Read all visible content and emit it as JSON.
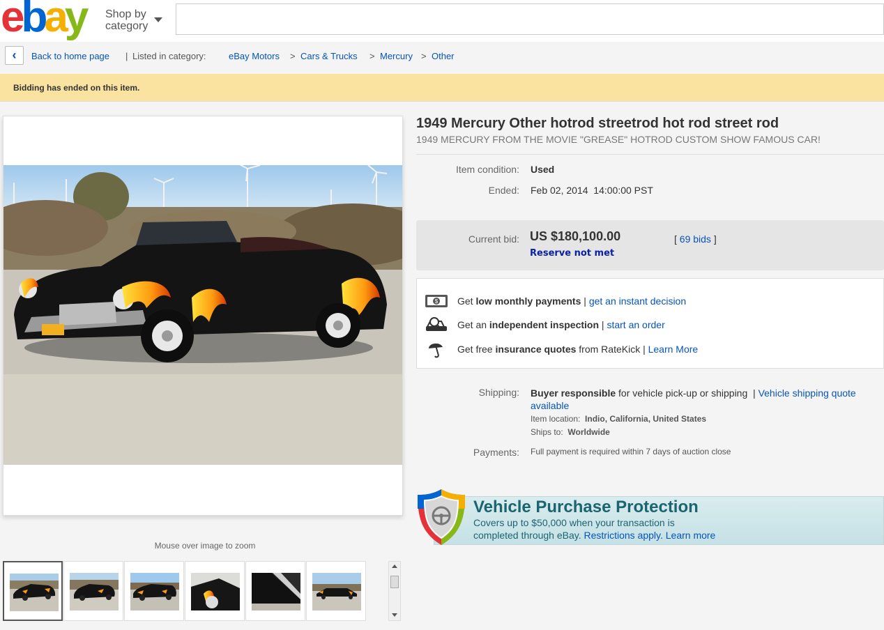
{
  "header": {
    "logo_text": "ebay",
    "shop_by_line1": "Shop by",
    "shop_by_line2": "category",
    "search_placeholder": ""
  },
  "breadcrumb": {
    "back_label": "Back to home page",
    "separator": "|",
    "listed_in": "Listed in category:",
    "items": [
      "eBay Motors",
      "Cars & Trucks",
      "Mercury",
      "Other"
    ],
    "arrow": ">"
  },
  "banner": {
    "text": "Bidding has ended on this item."
  },
  "gallery": {
    "zoom_hint": "Mouse over image to zoom",
    "thumbnail_count": 6
  },
  "listing": {
    "title": "1949 Mercury Other hotrod streetrod hot rod street rod",
    "subtitle": "1949 MERCURY FROM THE MOVIE \"GREASE\" HOTROD CUSTOM SHOW FAMOUS CAR!",
    "condition_label": "Item condition:",
    "condition_value": "Used",
    "ended_label": "Ended:",
    "ended_value": "Feb 02, 2014  14:00:00 PST"
  },
  "bid": {
    "label": "Current bid:",
    "price": "US $180,100.00",
    "reserve": "Reserve not met",
    "bids_open": "[",
    "bids_link": "69 bids",
    "bids_close": "]"
  },
  "offers": [
    {
      "icon": "money-icon",
      "pre": "Get ",
      "bold": "low monthly payments",
      "mid": " | ",
      "link": "get an instant decision"
    },
    {
      "icon": "inspection-icon",
      "pre": "Get an ",
      "bold": "independent inspection",
      "mid": " | ",
      "link": "start an order"
    },
    {
      "icon": "umbrella-icon",
      "pre": "Get free ",
      "bold": "insurance quotes",
      "mid": " from RateKick | ",
      "link": "Learn More"
    }
  ],
  "shipping": {
    "label": "Shipping:",
    "bold": "Buyer responsible",
    "text": " for vehicle pick-up or shipping",
    "sep": "|",
    "link_part1": "Vehicle shipping quote",
    "link_part2": "available",
    "location_label": "Item location:",
    "location_value": "Indio, California, United States",
    "ships_label": "Ships to:",
    "ships_value": "Worldwide"
  },
  "payments": {
    "label": "Payments:",
    "value": "Full payment is required within 7 days of auction close"
  },
  "protection": {
    "heading": "Vehicle Purchase Protection",
    "line1": "Covers up to $50,000 when your transaction is",
    "line2_pre": "completed through eBay. ",
    "link1": "Restrictions apply.",
    "link2": "Learn more"
  },
  "colors": {
    "accent": "#0654ba",
    "banner": "#fae2a0",
    "reserve": "#0a21a6"
  }
}
